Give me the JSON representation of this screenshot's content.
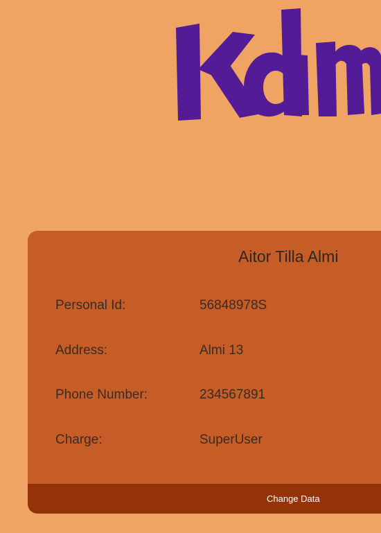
{
  "logo": {
    "text": "Kalm",
    "color": "#541b96"
  },
  "profile": {
    "name": "Aitor Tilla Almi",
    "rows": [
      {
        "label": "Personal Id:",
        "value": "56848978S"
      },
      {
        "label": "Address:",
        "value": "Almi 13"
      },
      {
        "label": "Phone Number:",
        "value": "234567891"
      },
      {
        "label": "Charge:",
        "value": "SuperUser"
      }
    ],
    "change_button_label": "Change Data"
  },
  "colors": {
    "background": "#efa463",
    "card": "#c65d27",
    "footer": "#943307",
    "logo": "#541b96"
  }
}
